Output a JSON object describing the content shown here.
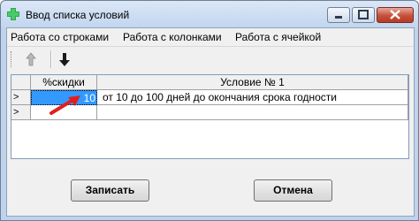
{
  "window": {
    "title": "Ввод списка условий"
  },
  "menu": {
    "items": [
      "Работа со строками",
      "Работа с колонками",
      "Работа с ячейкой"
    ]
  },
  "toolbar": {
    "buttons": [
      "arrow-up-icon",
      "arrow-down-icon"
    ]
  },
  "grid": {
    "headers": [
      "",
      "%скидки",
      "Условие № 1"
    ],
    "rows": [
      {
        "indicator": ">",
        "discount": "10",
        "condition": "от 10 до 100 дней до окончания срока годности"
      },
      {
        "indicator": ">",
        "discount": "",
        "condition": ""
      }
    ]
  },
  "buttons": {
    "save": "Записать",
    "cancel": "Отмена"
  },
  "colors": {
    "selection": "#3399ff",
    "annotation_arrow": "#e02020"
  }
}
